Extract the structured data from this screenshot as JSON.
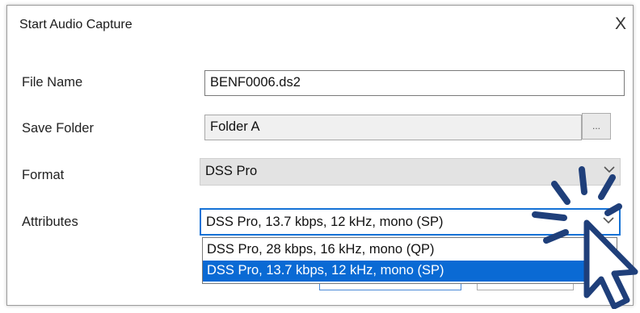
{
  "dialog": {
    "title": "Start Audio Capture",
    "close_glyph": "X"
  },
  "form": {
    "file_name_label": "File Name",
    "file_name_value": "BENF0006.ds2",
    "save_folder_label": "Save Folder",
    "save_folder_value": "Folder A",
    "browse_label": "...",
    "format_label": "Format",
    "format_value": "DSS Pro",
    "attributes_label": "Attributes",
    "attributes_value": "DSS Pro, 13.7 kbps, 12 kHz, mono (SP)"
  },
  "attributes_dropdown": {
    "options": [
      "DSS Pro, 28 kbps, 16 kHz, mono (QP)",
      "DSS Pro, 13.7 kbps, 12 kHz, mono (SP)"
    ],
    "selected_index": 1
  },
  "icons": {
    "chevron": "chevron-down-icon",
    "pointer": "click-pointer-icon"
  },
  "colors": {
    "accent": "#0a6ad4",
    "pointer_stroke": "#1f3f7a"
  }
}
